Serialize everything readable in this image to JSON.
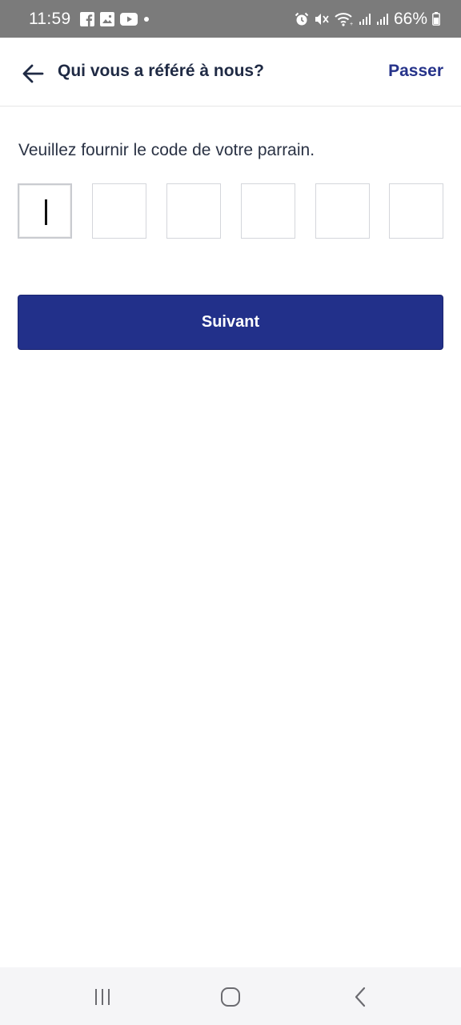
{
  "status_bar": {
    "time": "11:59",
    "battery_percent": "66%",
    "left_icons": [
      "facebook-icon",
      "gallery-icon",
      "youtube-icon",
      "dot-icon"
    ],
    "right_icons": [
      "alarm-icon",
      "mute-icon",
      "wifi-icon",
      "signal-icon",
      "signal-icon",
      "battery-icon"
    ]
  },
  "app_bar": {
    "title": "Qui vous a référé à nous?",
    "skip_label": "Passer",
    "back_icon": "arrow-left-icon"
  },
  "main": {
    "instruction": "Veuillez fournir le code de votre parrain.",
    "code_length": 6,
    "code_values": [
      "",
      "",
      "",
      "",
      "",
      ""
    ],
    "active_index": 0,
    "next_label": "Suivant"
  },
  "nav_bar": {
    "buttons": [
      "recents-icon",
      "home-icon",
      "back-icon"
    ]
  },
  "colors": {
    "status_bar_bg": "#7b7b7b",
    "primary": "#22308a",
    "title_text": "#1f2a44",
    "nav_bg": "#f5f5f7"
  }
}
